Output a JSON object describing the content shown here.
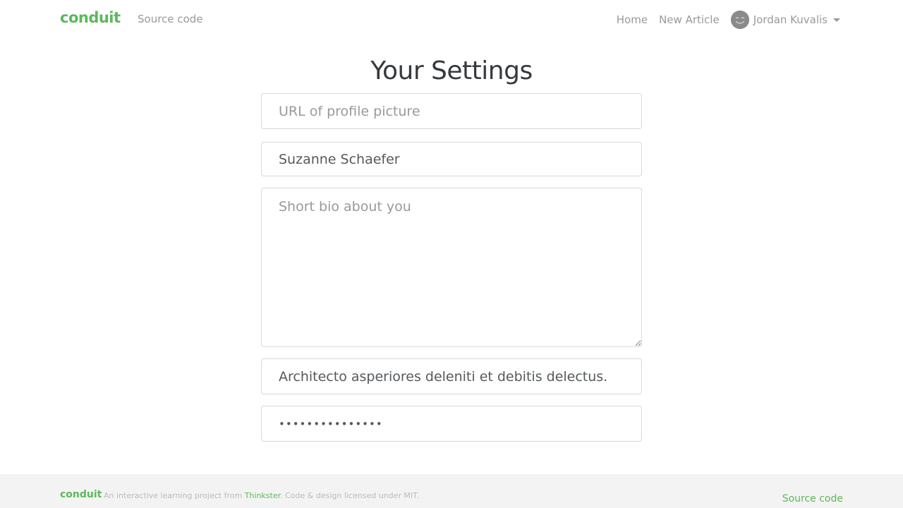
{
  "nav": {
    "brand": "conduit",
    "source_code": "Source code",
    "home": "Home",
    "new_article": "New Article",
    "user_name": "Jordan Kuvalis"
  },
  "page": {
    "title": "Your Settings"
  },
  "form": {
    "image_placeholder": "URL of profile picture",
    "image_value": "",
    "username_value": "Suzanne Schaefer",
    "bio_placeholder": "Short bio about you",
    "bio_value": "",
    "email_value": "Architecto asperiores deleniti et debitis delectus.",
    "password_value": "•••••••••••••••"
  },
  "footer": {
    "brand": "conduit",
    "text_prefix": "An interactive learning project from ",
    "link": "Thinkster",
    "text_suffix": ". Code & design licensed under MIT.",
    "source_code": "Source code"
  },
  "colors": {
    "brand": "#5cb85c",
    "nav_text": "#999999",
    "footer_bg": "#f3f3f3"
  },
  "icons": {
    "avatar": "smiley-avatar-icon",
    "dropdown": "caret-down-icon"
  }
}
